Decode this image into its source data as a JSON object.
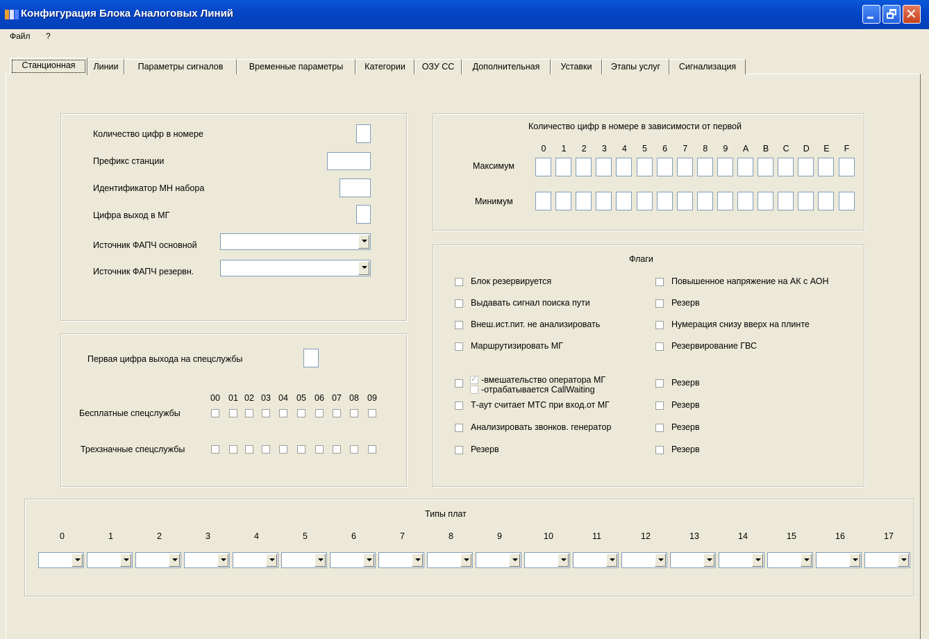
{
  "window": {
    "title": "Конфигурация Блока Аналоговых Линий",
    "icon": "app-icon"
  },
  "menu": [
    "Файл",
    "?"
  ],
  "tabs": [
    "Станционная",
    "Линии",
    "Параметры сигналов",
    "Временные параметры",
    "Категории",
    "ОЗУ СС",
    "Дополнительная",
    "Уставки",
    "Этапы услуг",
    "Сигнализация"
  ],
  "station": {
    "digits_label": "Количество цифр в номере",
    "prefix_label": "Префикс станции",
    "mn_label": "Идентификатор МН набора",
    "mg_label": "Цифра выход в МГ",
    "pll_main_label": "Источник ФАПЧ основной",
    "pll_reserve_label": "Источник ФАПЧ резервн."
  },
  "special": {
    "first_digit_label": "Первая цифра выхода на спецслужбы",
    "codes": [
      "00",
      "01",
      "02",
      "03",
      "04",
      "05",
      "06",
      "07",
      "08",
      "09"
    ],
    "free_label": "Бесплатные спецслужбы",
    "three_digit_label": "Трехзначные спецслужбы"
  },
  "digits_by_first": {
    "title": "Количество цифр в номере в зависимости от первой",
    "columns": [
      "0",
      "1",
      "2",
      "3",
      "4",
      "5",
      "6",
      "7",
      "8",
      "9",
      "A",
      "B",
      "C",
      "D",
      "E",
      "F"
    ],
    "max_label": "Максимум",
    "min_label": "Минимум"
  },
  "flags": {
    "title": "Флаги",
    "left": [
      "Блок резервируется",
      "Выдавать сигнал поиска пути",
      "Внеш.ист.пит. не анализировать",
      "Маршрутизировать МГ"
    ],
    "right": [
      "Повышенное напряжение на АК с АОН",
      "Резерв",
      "Нумерация снизу вверх на плинте",
      "Резервирование ГВС"
    ],
    "operator_line1": "-вмешательство оператора МГ",
    "operator_line2": "-отрабатывается CallWaiting",
    "left2": [
      "Т-аут считает МТС при вход.от МГ",
      "Анализировать звонков. генератор",
      "Резерв"
    ],
    "right2": [
      "Резерв",
      "Резерв",
      "Резерв",
      "Резерв"
    ]
  },
  "board_types": {
    "title": "Типы плат",
    "slots": [
      "0",
      "1",
      "2",
      "3",
      "4",
      "5",
      "6",
      "7",
      "8",
      "9",
      "10",
      "11",
      "12",
      "13",
      "14",
      "15",
      "16",
      "17"
    ]
  },
  "colors": {
    "titlebar": "#0546c8",
    "face": "#ece9d8"
  }
}
